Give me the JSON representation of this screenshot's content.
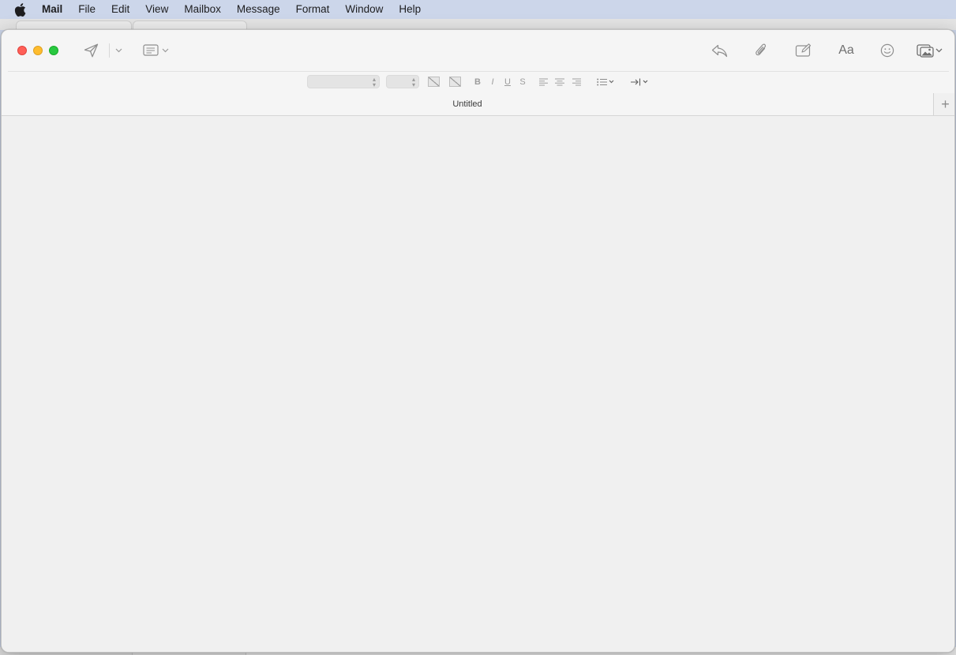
{
  "menubar": {
    "app_name": "Mail",
    "items": [
      "File",
      "Edit",
      "View",
      "Mailbox",
      "Message",
      "Format",
      "Window",
      "Help"
    ]
  },
  "window": {
    "tab_title": "Untitled",
    "tab_add_label": "+",
    "font_button_label": "Aa"
  },
  "format_bar": {
    "bold": "B",
    "italic": "I",
    "underline": "U",
    "strikethrough": "S"
  },
  "icons": {
    "send": "paper-plane-icon",
    "header_fields": "header-fields-icon",
    "reply": "reply-icon",
    "attach": "paperclip-icon",
    "markup": "compose-markup-icon",
    "fonts": "fonts-icon",
    "emoji": "smiley-icon",
    "photo": "photo-browser-icon"
  },
  "colors": {
    "close": "#ff5f57",
    "minimize": "#febc2e",
    "zoom": "#28c840",
    "menubar": "#ccd6ea",
    "window": "#f0f0f0"
  }
}
